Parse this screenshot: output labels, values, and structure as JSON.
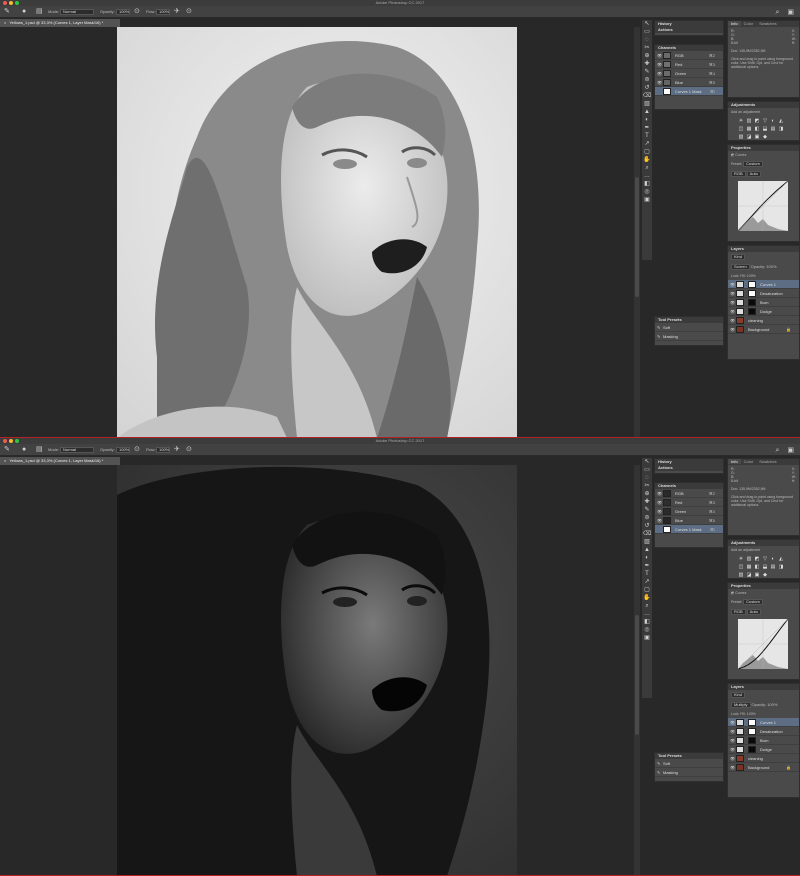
{
  "app": {
    "title": "Adobe Photoshop CC 2017",
    "doc_tab": "Yellows_1.psd @ 33,3% (Curves 1, Layer Mask/16) *"
  },
  "options": {
    "mode_label": "Mode:",
    "mode_value": "Normal",
    "opacity_label": "Opacity:",
    "opacity_value": "100%",
    "flow_label": "Flow:",
    "flow_value": "100%"
  },
  "tools": [
    "↖",
    "▭",
    "◌",
    "✂",
    "⊕",
    "✎",
    "⌫",
    "✐",
    "◐",
    "◢",
    "⊘",
    "▲",
    "T",
    "↗",
    "▭",
    "✋",
    "🔍",
    "…",
    "◧",
    "◨",
    "▣",
    "▢"
  ],
  "panels": {
    "history": "History",
    "actions": "Actions",
    "channels": "Channels",
    "channel_rows": [
      {
        "name": "RGB",
        "shortcut": "⌘2",
        "color": "#6a6a6a"
      },
      {
        "name": "Red",
        "shortcut": "⌘3",
        "color": "#707070"
      },
      {
        "name": "Green",
        "shortcut": "⌘4",
        "color": "#6c6c6c"
      },
      {
        "name": "Blue",
        "shortcut": "⌘5",
        "color": "#646464"
      },
      {
        "name": "Curves 1 Mask",
        "shortcut": "⌘\\",
        "color": "#ffffff"
      }
    ],
    "tool_presets": "Tool Presets",
    "preset_items": [
      "Soft",
      "Masking"
    ],
    "info_tabs": [
      "Info",
      "Color",
      "Swatches"
    ],
    "info_lines": [
      "R:",
      "G:",
      "B:",
      "8-bit",
      "X:",
      "Y:",
      "W:",
      "H:"
    ],
    "doc_info": "Doc: 135,9M/2352,9M",
    "hint": "Click and drag to paint using foreground color. Use Shift, Opt, and Cmd for additional options.",
    "adjustments": "Adjustments",
    "adj_sub": "Add an adjustment",
    "adj_icons": [
      "☀",
      "▥",
      "◩",
      "▽",
      "◐",
      "◭",
      "◫",
      "▦",
      "◧",
      "⬓",
      "▤",
      "◨",
      "▧",
      "◪",
      "▣",
      "◆"
    ],
    "properties": "Properties",
    "curves": "Curves",
    "preset_label": "Preset:",
    "preset_value": "Custom",
    "channel_value": "RGB",
    "auto": "Auto",
    "layers": "Layers",
    "kind": "Kind",
    "blend_top": "Screen",
    "blend_bottom": "Multiply",
    "opacity_label": "Opacity:",
    "opacity_value": "100%",
    "lock_label": "Lock:",
    "fill_label": "Fill:",
    "fill_value": "100%",
    "layer_rows": [
      {
        "name": "Curves 1",
        "selected": true,
        "thumb": "#ffffff"
      },
      {
        "name": "Desaturation",
        "selected": false,
        "thumb": "#ffffff"
      },
      {
        "name": "Burn",
        "selected": false,
        "thumb": "#0a0a0a"
      },
      {
        "name": "Dodge",
        "selected": false,
        "thumb": "#0a0a0a"
      },
      {
        "name": "cleaning",
        "selected": false,
        "thumb": "#8a3a2a"
      },
      {
        "name": "Background",
        "selected": false,
        "thumb": "#7a3322"
      }
    ]
  },
  "colors": {
    "chrome": "#3c3c3c",
    "panel": "#4a4a4a",
    "selected": "#5d6e84",
    "close": "#ee5c50",
    "minimize": "#f4bc2e",
    "zoom": "#2bc840"
  }
}
